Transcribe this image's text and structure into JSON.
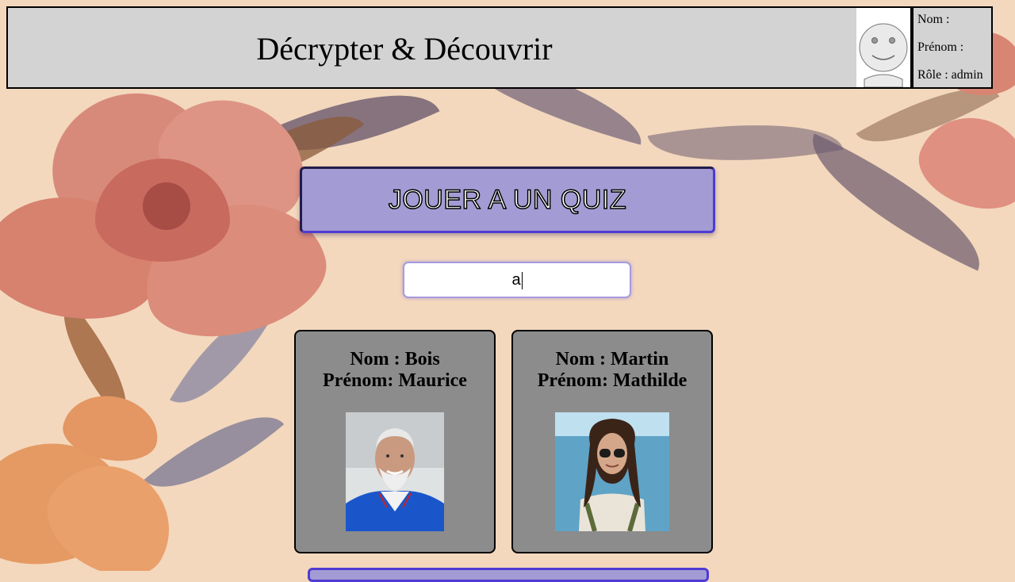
{
  "header": {
    "title": "Décrypter & Découvrir"
  },
  "user": {
    "nom_label": "Nom :",
    "prenom_label": "Prénom :",
    "role_label": "Rôle : admin",
    "avatar_icon": "smiley-avatar-icon"
  },
  "main": {
    "quiz_button_label": "JOUER A UN QUIZ",
    "search_value": "a"
  },
  "cards": [
    {
      "nom": "Nom : Bois",
      "prenom": "Prénom: Maurice"
    },
    {
      "nom": "Nom : Martin",
      "prenom": "Prénom: Mathilde"
    }
  ],
  "colors": {
    "header_bg": "#d3d3d3",
    "button_bg": "#a39cd4",
    "button_border": "#4f3bd2",
    "card_bg": "#8c8c8c",
    "page_bg": "#f3d8bd"
  }
}
